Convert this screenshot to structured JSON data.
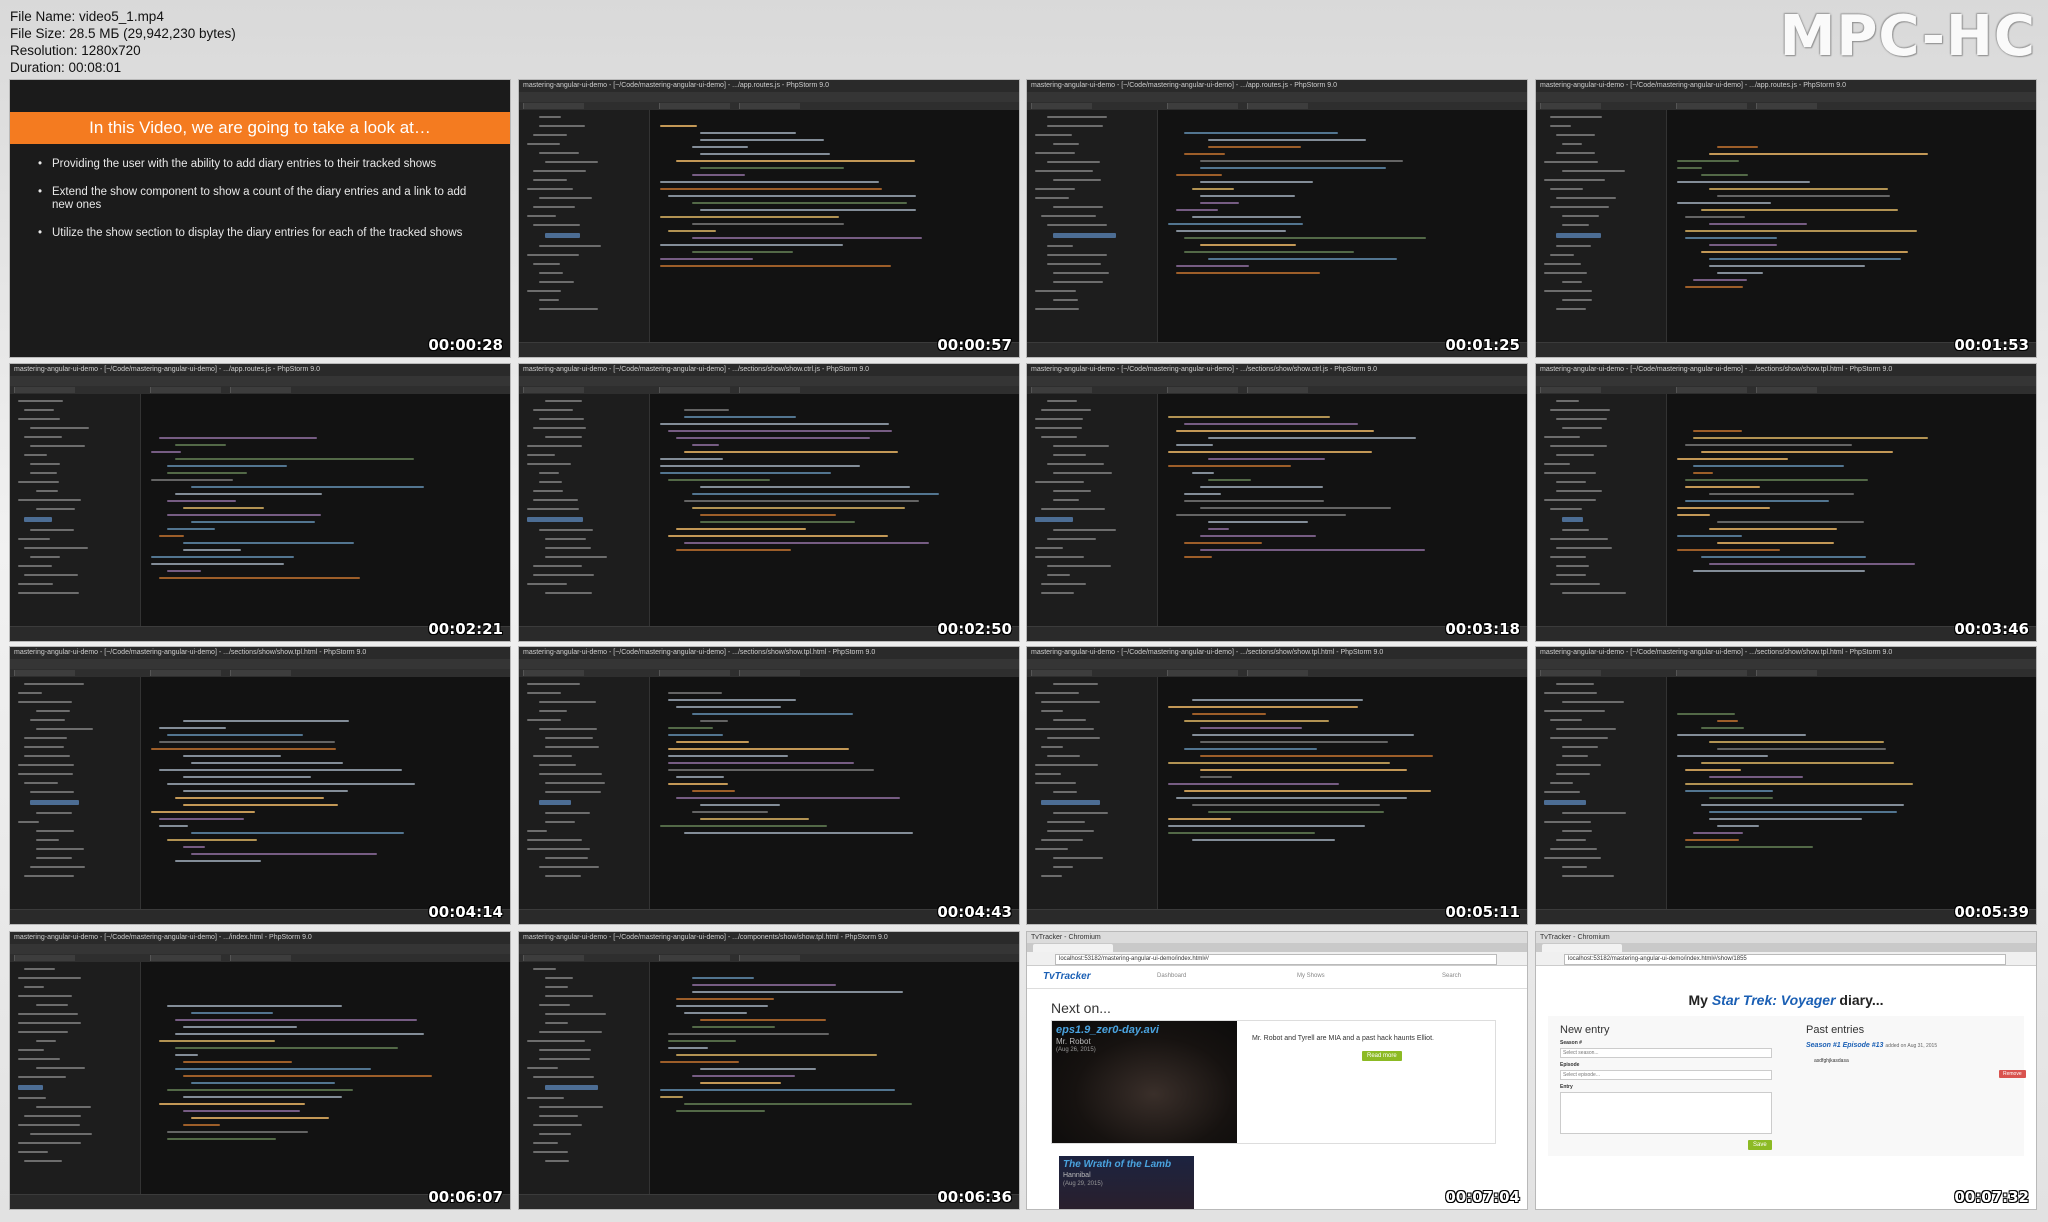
{
  "file_info": {
    "name": "File Name: video5_1.mp4",
    "size": "File Size: 28.5 МБ (29,942,230 bytes)",
    "resolution": "Resolution: 1280x720",
    "duration": "Duration: 00:08:01"
  },
  "logo": "MPC-HC",
  "thumbnails": [
    {
      "kind": "slide",
      "time": "00:00:28"
    },
    {
      "kind": "ide",
      "time": "00:00:57",
      "title": "mastering-angular-ui-demo - [~/Code/mastering-angular-ui-demo] - .../app.routes.js - PhpStorm 9.0"
    },
    {
      "kind": "ide",
      "time": "00:01:25",
      "title": "mastering-angular-ui-demo - [~/Code/mastering-angular-ui-demo] - .../app.routes.js - PhpStorm 9.0"
    },
    {
      "kind": "ide",
      "time": "00:01:53",
      "title": "mastering-angular-ui-demo - [~/Code/mastering-angular-ui-demo] - .../app.routes.js - PhpStorm 9.0"
    },
    {
      "kind": "ide",
      "time": "00:02:21",
      "title": "mastering-angular-ui-demo - [~/Code/mastering-angular-ui-demo] - .../app.routes.js - PhpStorm 9.0"
    },
    {
      "kind": "ide",
      "time": "00:02:50",
      "title": "mastering-angular-ui-demo - [~/Code/mastering-angular-ui-demo] - .../sections/show/show.ctrl.js - PhpStorm 9.0"
    },
    {
      "kind": "ide",
      "time": "00:03:18",
      "title": "mastering-angular-ui-demo - [~/Code/mastering-angular-ui-demo] - .../sections/show/show.ctrl.js - PhpStorm 9.0"
    },
    {
      "kind": "ide",
      "time": "00:03:46",
      "title": "mastering-angular-ui-demo - [~/Code/mastering-angular-ui-demo] - .../sections/show/show.tpl.html - PhpStorm 9.0"
    },
    {
      "kind": "ide",
      "time": "00:04:14",
      "title": "mastering-angular-ui-demo - [~/Code/mastering-angular-ui-demo] - .../sections/show/show.tpl.html - PhpStorm 9.0"
    },
    {
      "kind": "ide",
      "time": "00:04:43",
      "title": "mastering-angular-ui-demo - [~/Code/mastering-angular-ui-demo] - .../sections/show/show.tpl.html - PhpStorm 9.0"
    },
    {
      "kind": "ide",
      "time": "00:05:11",
      "title": "mastering-angular-ui-demo - [~/Code/mastering-angular-ui-demo] - .../sections/show/show.tpl.html - PhpStorm 9.0"
    },
    {
      "kind": "ide",
      "time": "00:05:39",
      "title": "mastering-angular-ui-demo - [~/Code/mastering-angular-ui-demo] - .../sections/show/show.tpl.html - PhpStorm 9.0"
    },
    {
      "kind": "ide",
      "time": "00:06:07",
      "title": "mastering-angular-ui-demo - [~/Code/mastering-angular-ui-demo] - .../index.html - PhpStorm 9.0"
    },
    {
      "kind": "ide",
      "time": "00:06:36",
      "title": "mastering-angular-ui-demo - [~/Code/mastering-angular-ui-demo] - .../components/show/show.tpl.html - PhpStorm 9.0"
    },
    {
      "kind": "browser1",
      "time": "00:07:04"
    },
    {
      "kind": "browser2",
      "time": "00:07:32"
    }
  ],
  "slide": {
    "heading": "In this Video, we are going to take a look at…",
    "bullets": [
      "Providing the user with the ability to add diary entries to their tracked shows",
      "Extend the show component to show a count of the diary entries and a link to add new ones",
      "Utilize the show section to display the diary entries for each of the tracked shows"
    ]
  },
  "browser1": {
    "window_title": "TvTracker - Chromium",
    "url": "localhost:53182/mastering-angular-ui-demo/index.html#/",
    "brand": "TvTracker",
    "nav": [
      "Dashboard",
      "My Shows",
      "Search"
    ],
    "section": "Next on...",
    "card_title": "eps1.9_zer0-day.avi",
    "card_sub": "Mr. Robot",
    "card_date": "(Aug 26, 2015)",
    "card_desc": "Mr. Robot and Tyrell are MIA and a past hack haunts Elliot.",
    "card_button": "Read more",
    "card2_title": "The Wrath of the Lamb",
    "card2_sub": "Hannibal",
    "card2_date": "(Aug 29, 2015)"
  },
  "browser2": {
    "window_title": "TvTracker - Chromium",
    "url": "localhost:53182/mastering-angular-ui-demo/index.html#/show/1855",
    "heading_prefix": "My ",
    "heading_show": "Star Trek: Voyager",
    "heading_suffix": " diary...",
    "new_entry": "New entry",
    "season_label": "Season #",
    "season_placeholder": "Select season...",
    "episode_label": "Episode",
    "episode_placeholder": "Select episode...",
    "entry_label": "Entry",
    "save_button": "Save",
    "past_entries": "Past entries",
    "past_entry_title": "Season #1 Episode #13",
    "past_entry_meta": "added on Aug 31, 2015",
    "past_entry_text": "asdfghjkasdasa",
    "remove_button": "Remove"
  },
  "colors": {
    "accent_orange": "#f47b20",
    "save_green": "#8cba24",
    "remove_red": "#d9534f",
    "diary_blue": "#1a5fb4"
  }
}
